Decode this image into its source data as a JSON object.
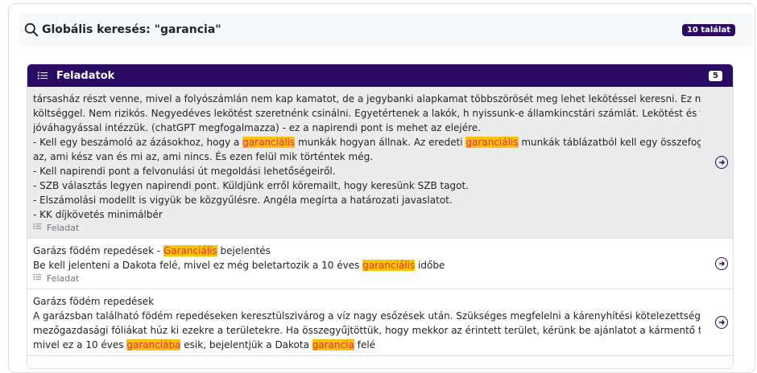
{
  "search": {
    "title": "Globális keresés: \"garancia\"",
    "hits": "10 találat"
  },
  "section": {
    "title": "Feladatok",
    "count": "5"
  },
  "results": [
    {
      "lines": [
        [
          {
            "t": "társasház részt venne, mivel a folyószámlán nem kap kamatot, de a jegybanki alapkamat többszörösét meg lehet lekötéssel keresni. Ez nem jár plusz"
          }
        ],
        [
          {
            "t": "költséggel. Nem rizikós. Negyedéves lekötést szeretnénk csinálni. Egyetértenek a lakók, h nyissunk-e államkincstári számlát. Lekötést és felbontást SZB"
          }
        ],
        [
          {
            "t": "jóváhagyással intézzük. (chatGPT megfogalmazza) - ez a napirendi pont is mehet az elejére."
          }
        ],
        [
          {
            "t": "- Kell egy beszámoló az ázásokhoz, hogy a "
          },
          {
            "t": "garanciális",
            "h": true
          },
          {
            "t": " munkák hogyan állnak. Az eredeti "
          },
          {
            "t": "garanciális",
            "h": true
          },
          {
            "t": " munkák táblázatból kell egy összefoglalás, hogy mi"
          }
        ],
        [
          {
            "t": "az, ami kész van és mi az, ami nincs. És ezen felül mik történtek még."
          }
        ],
        [
          {
            "t": "- Kell napirendi pont a felvonulási út megoldási lehetőségeiről."
          }
        ],
        [
          {
            "t": "- SZB választás legyen napirendi pont. Küldjünk erről köremailt, hogy keresünk SZB tagot."
          }
        ],
        [
          {
            "t": "- Elszámolási modellt is vigyük be közgyűlésre. Angéla megírta a határozati javaslatot."
          }
        ],
        [
          {
            "t": "- KK díjkövetés minimálbér"
          }
        ]
      ],
      "meta": "Feladat"
    },
    {
      "lines": [
        [
          {
            "t": "Garázs födém repedések - "
          },
          {
            "t": "Garanciális",
            "h": true
          },
          {
            "t": " bejelentés"
          }
        ],
        [
          {
            "t": "Be kell jelenteni a Dakota felé, mivel ez még beletartozik a 10 éves "
          },
          {
            "t": "garanciális",
            "h": true
          },
          {
            "t": " időbe"
          }
        ]
      ],
      "meta": "Feladat"
    },
    {
      "lines": [
        [
          {
            "t": "Garázs födém repedések"
          }
        ],
        [
          {
            "t": "A garázsban található födém repedéseken keresztülszivárog a víz nagy esőzések után. Szükséges megfelelni a kárenyhítési kötelezettségünknek, ezért Lali"
          }
        ],
        [
          {
            "t": "mezőgazdasági fóliákat húz ki ezekre a területekre. Ha összegyűjtöttük, hogy mekkor az érintett terület, kérünk be ajánlatot a kármentő tálcákra. Közben,"
          }
        ],
        [
          {
            "t": "mivel ez a 10 éves "
          },
          {
            "t": "garanciába",
            "h": true
          },
          {
            "t": " esik, bejelentjük a Dakota "
          },
          {
            "t": "garancia",
            "h": true
          },
          {
            "t": " felé"
          }
        ]
      ],
      "meta": ""
    }
  ]
}
